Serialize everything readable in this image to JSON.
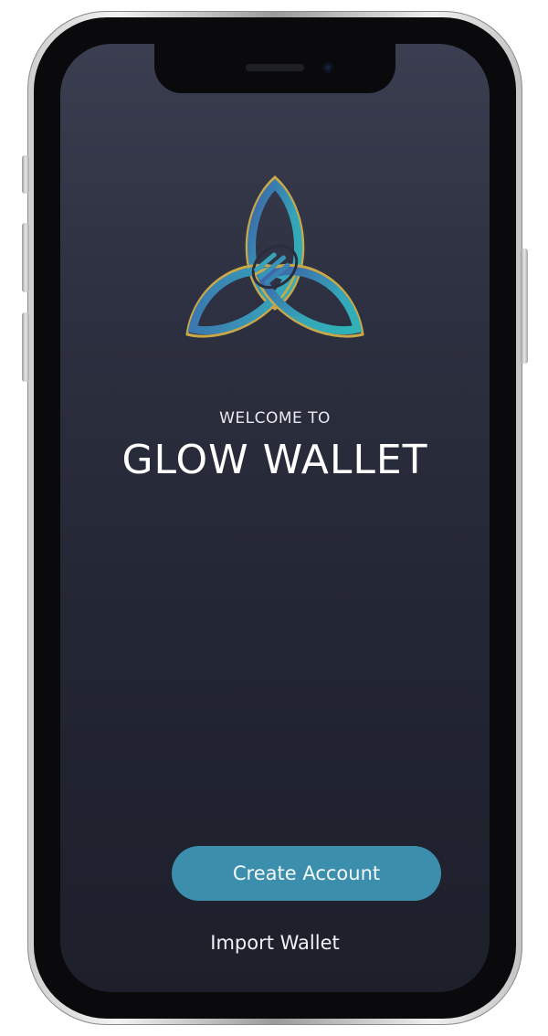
{
  "welcome_screen": {
    "welcome_text": "WELCOME TO",
    "app_name": "GLOW WALLET",
    "create_account_label": "Create Account",
    "import_wallet_label": "Import Wallet"
  },
  "colors": {
    "background_top": "#3a3e50",
    "background_bottom": "#1d1f2b",
    "button": "#3c8fac",
    "logo_gradient": [
      "#3e5fa8",
      "#35a4b8",
      "#c9a84a"
    ]
  },
  "icons": {
    "logo": "glow-triquetra-logo"
  }
}
